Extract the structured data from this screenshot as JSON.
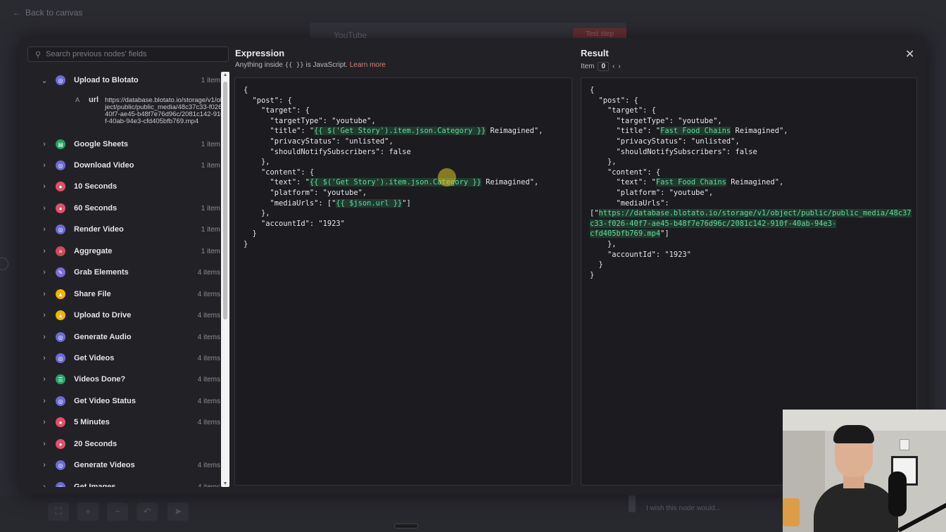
{
  "canvas": {
    "back_label": "Back to canvas",
    "node_title": "YouTube",
    "test_step_label": "Test step",
    "feedback_placeholder": "I wish this node would..."
  },
  "search": {
    "placeholder": "Search previous nodes' fields"
  },
  "nodes": [
    {
      "name": "Upload to Blotato",
      "count": "1 item",
      "expanded": true,
      "icon": "globe-icon",
      "color": "#6b6bd6"
    },
    {
      "name": "Google Sheets",
      "count": "1 item",
      "icon": "sheets-icon",
      "color": "#1fa463"
    },
    {
      "name": "Download Video",
      "count": "1 item",
      "icon": "globe-icon",
      "color": "#6b6bd6"
    },
    {
      "name": "10 Seconds",
      "count": "",
      "icon": "wait-icon",
      "color": "#e0506b"
    },
    {
      "name": "60 Seconds",
      "count": "1 item",
      "icon": "wait-icon",
      "color": "#e0506b"
    },
    {
      "name": "Render Video",
      "count": "1 item",
      "icon": "globe-icon",
      "color": "#6b6bd6"
    },
    {
      "name": "Aggregate",
      "count": "1 item",
      "icon": "aggregate-icon",
      "color": "#d04a5a"
    },
    {
      "name": "Grab Elements",
      "count": "4 items",
      "icon": "pen-icon",
      "color": "#7b6bd6"
    },
    {
      "name": "Share File",
      "count": "4 items",
      "icon": "drive-icon",
      "color": "#f2b300"
    },
    {
      "name": "Upload to Drive",
      "count": "4 items",
      "icon": "drive-icon",
      "color": "#f2b300"
    },
    {
      "name": "Generate Audio",
      "count": "4 items",
      "icon": "globe-icon",
      "color": "#6b6bd6"
    },
    {
      "name": "Get Videos",
      "count": "4 items",
      "icon": "globe-icon",
      "color": "#6b6bd6"
    },
    {
      "name": "Videos Done?",
      "count": "4 items",
      "icon": "filter-icon",
      "color": "#29a36a"
    },
    {
      "name": "Get Video Status",
      "count": "4 items",
      "icon": "globe-icon",
      "color": "#6b6bd6"
    },
    {
      "name": "5 Minutes",
      "count": "4 items",
      "icon": "wait-icon",
      "color": "#e0506b"
    },
    {
      "name": "20 Seconds",
      "count": "",
      "icon": "wait-icon",
      "color": "#e0506b"
    },
    {
      "name": "Generate Videos",
      "count": "4 items",
      "icon": "globe-icon",
      "color": "#6b6bd6"
    },
    {
      "name": "Get Images",
      "count": "4 items",
      "icon": "globe-icon",
      "color": "#6b6bd6"
    }
  ],
  "expanded_field": {
    "type": "A",
    "name": "url",
    "value": "https://database.blotato.io/storage/v1/object/public/public_media/48c37c33-f026-40f7-ae45-b48f7e76d96c/2081c142-910f-40ab-94e3-cfd405bfb769.mp4"
  },
  "expression": {
    "title": "Expression",
    "hint_prefix": "Anything inside",
    "hint_braces": "{{ }}",
    "hint_suffix": "is JavaScript.",
    "learn_more": "Learn more",
    "lines": [
      [
        {
          "t": "{"
        }
      ],
      [
        {
          "t": "  \"post\": {"
        }
      ],
      [
        {
          "t": "    \"target\": {"
        }
      ],
      [
        {
          "t": "      \"targetType\": \"youtube\","
        }
      ],
      [
        {
          "t": "      \"title\": \""
        },
        {
          "t": "{{ $('Get Story').item.json.Category }}",
          "h": true
        },
        {
          "t": " Reimagined\","
        }
      ],
      [
        {
          "t": "      \"privacyStatus\": \"unlisted\","
        }
      ],
      [
        {
          "t": "      \"shouldNotifySubscribers\": false"
        }
      ],
      [
        {
          "t": "    },"
        }
      ],
      [
        {
          "t": "    \"content\": {"
        }
      ],
      [
        {
          "t": "      \"text\": \""
        },
        {
          "t": "{{ $('Get Story').item.json.Category }}",
          "h": true
        },
        {
          "t": " Reimagined\","
        }
      ],
      [
        {
          "t": "      \"platform\": \"youtube\","
        }
      ],
      [
        {
          "t": "      \"mediaUrls\": [\""
        },
        {
          "t": "{{ $json.url }}",
          "h": true
        },
        {
          "t": "\"]"
        }
      ],
      [
        {
          "t": "    },"
        }
      ],
      [
        {
          "t": "    \"accountId\": \"1923\""
        }
      ],
      [
        {
          "t": "  }"
        }
      ],
      [
        {
          "t": "}"
        }
      ]
    ]
  },
  "result": {
    "title": "Result",
    "item_label": "Item",
    "item_index": "0",
    "lines": [
      [
        {
          "t": "{"
        }
      ],
      [
        {
          "t": "  \"post\": {"
        }
      ],
      [
        {
          "t": "    \"target\": {"
        }
      ],
      [
        {
          "t": "      \"targetType\": \"youtube\","
        }
      ],
      [
        {
          "t": "      \"title\": \""
        },
        {
          "t": "Fast Food Chains",
          "h": true
        },
        {
          "t": " Reimagined\","
        }
      ],
      [
        {
          "t": "      \"privacyStatus\": \"unlisted\","
        }
      ],
      [
        {
          "t": "      \"shouldNotifySubscribers\": false"
        }
      ],
      [
        {
          "t": "    },"
        }
      ],
      [
        {
          "t": "    \"content\": {"
        }
      ],
      [
        {
          "t": "      \"text\": \""
        },
        {
          "t": "Fast Food Chains",
          "h": true
        },
        {
          "t": " Reimagined\","
        }
      ],
      [
        {
          "t": "      \"platform\": \"youtube\","
        }
      ],
      [
        {
          "t": "      \"mediaUrls\":"
        }
      ],
      [
        {
          "t": "[\""
        },
        {
          "t": "https://database.blotato.io/storage/v1/object/public/public_media/48c37",
          "h": true
        }
      ],
      [
        {
          "t": "c33-f026-40f7-ae45-b48f7e76d96c/2081c142-910f-40ab-94e3-",
          "h": true
        }
      ],
      [
        {
          "t": "cfd405bfb769.mp4",
          "h": true
        },
        {
          "t": "\"]"
        }
      ],
      [
        {
          "t": "    },"
        }
      ],
      [
        {
          "t": "    \"accountId\": \"1923\""
        }
      ],
      [
        {
          "t": "  }"
        }
      ],
      [
        {
          "t": "}"
        }
      ]
    ]
  }
}
